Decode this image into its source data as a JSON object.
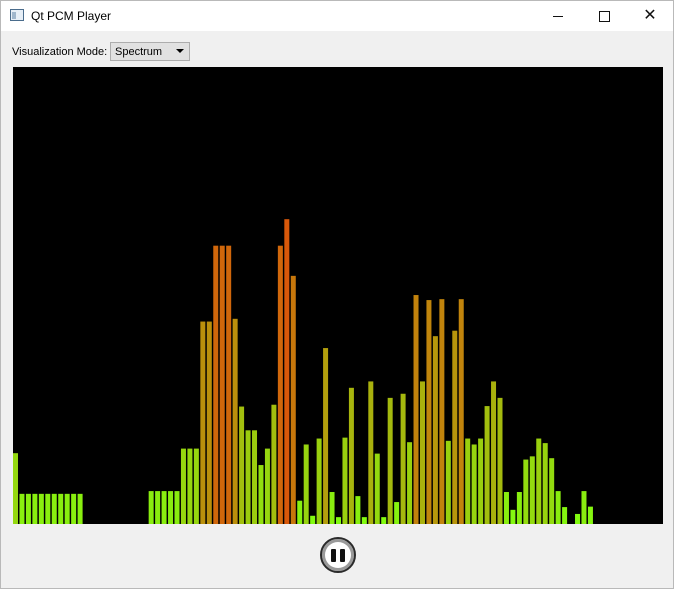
{
  "window": {
    "title": "Qt PCM Player"
  },
  "controls": {
    "mode_label": "Visualization Mode:",
    "mode_value": "Spectrum"
  },
  "chart_data": {
    "type": "bar",
    "values": [
      0.155,
      0.066,
      0.066,
      0.066,
      0.066,
      0.066,
      0.066,
      0.066,
      0.066,
      0.066,
      0.066,
      0,
      0,
      0,
      0,
      0,
      0,
      0,
      0,
      0,
      0,
      0.072,
      0.072,
      0.072,
      0.072,
      0.072,
      0.165,
      0.165,
      0.165,
      0.443,
      0.443,
      0.609,
      0.609,
      0.609,
      0.449,
      0.257,
      0.205,
      0.205,
      0.129,
      0.165,
      0.261,
      0.609,
      0.667,
      0.543,
      0.051,
      0.174,
      0.018,
      0.187,
      0.385,
      0.07,
      0.015,
      0.189,
      0.298,
      0.061,
      0.015,
      0.312,
      0.154,
      0.015,
      0.276,
      0.048,
      0.285,
      0.179,
      0.501,
      0.312,
      0.49,
      0.411,
      0.492,
      0.182,
      0.423,
      0.492,
      0.187,
      0.174,
      0.187,
      0.258,
      0.312,
      0.276,
      0.07,
      0.031,
      0.07,
      0.141,
      0.148,
      0.187,
      0.177,
      0.144,
      0.072,
      0.037,
      0.0,
      0.022,
      0.072,
      0.038
    ],
    "ylim": [
      0,
      1
    ]
  }
}
